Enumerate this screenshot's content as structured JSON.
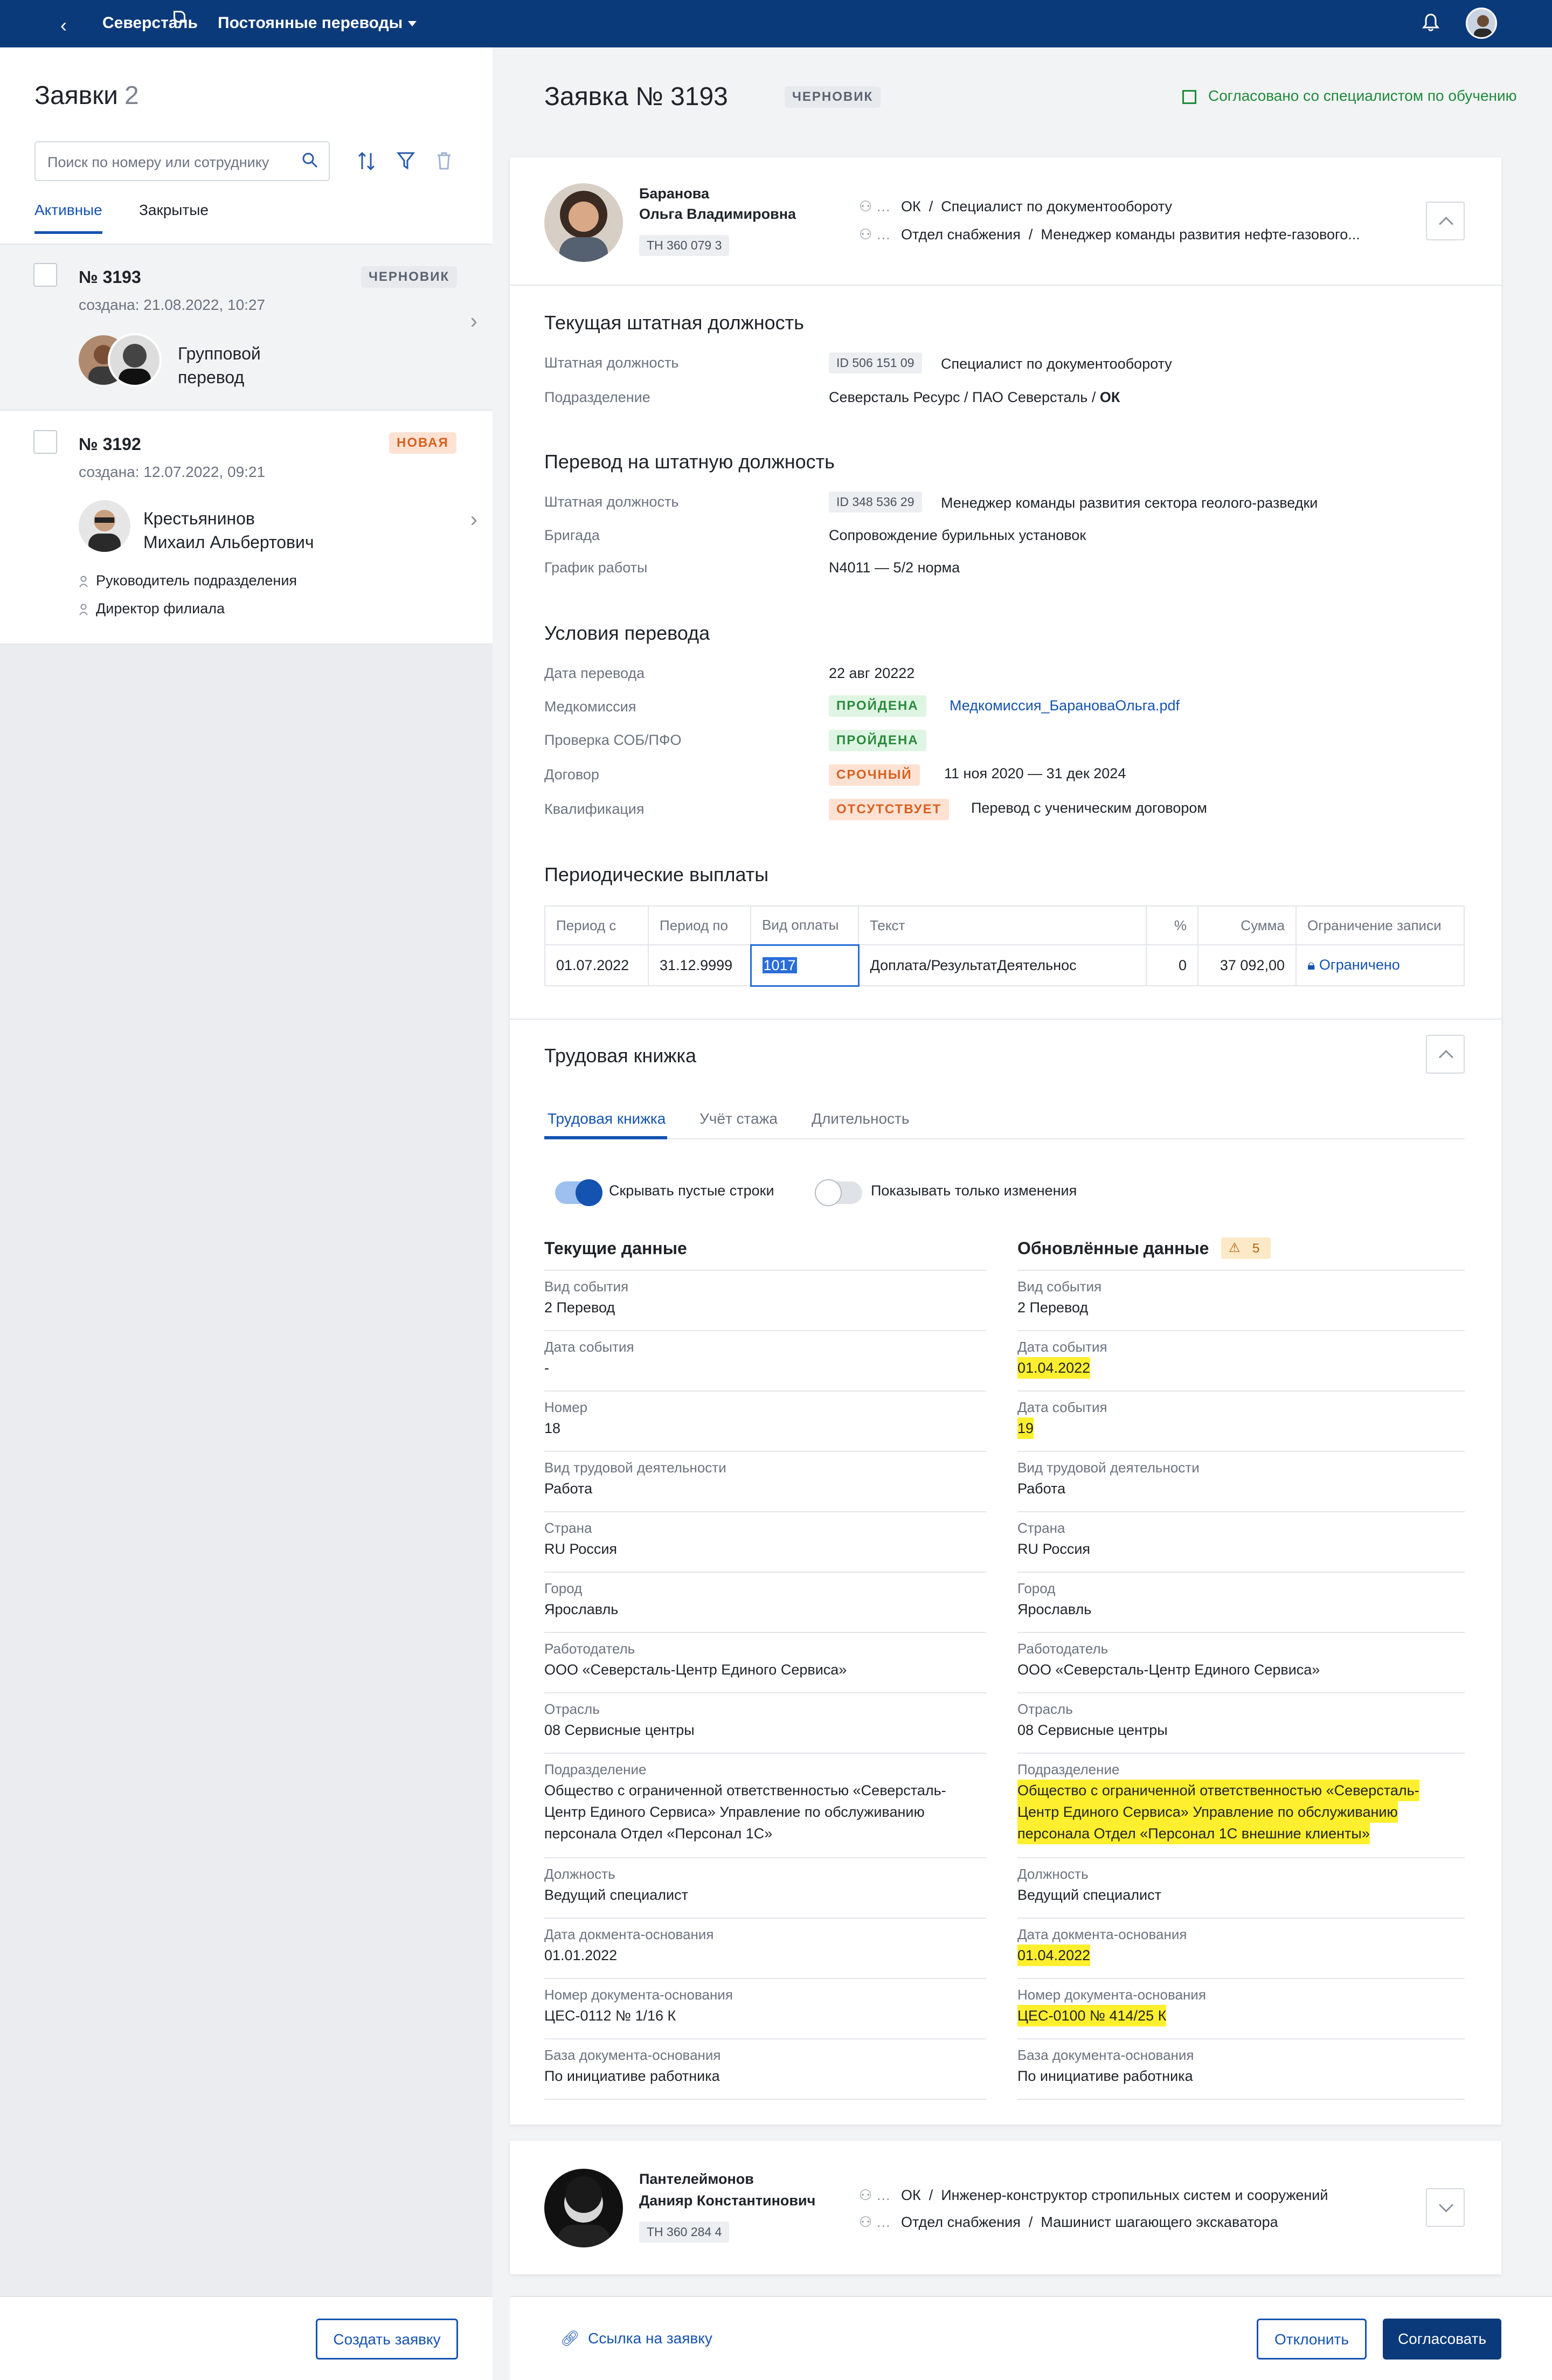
{
  "topbar": {
    "logo": "Северсталь",
    "menu": "Постоянные переводы"
  },
  "left": {
    "title": "Заявки",
    "count": "2",
    "search_placeholder": "Поиск по номеру или сотруднику",
    "tabs": [
      "Активные",
      "Закрытые"
    ],
    "cards": [
      {
        "num": "№ 3193",
        "created": "создана: 21.08.2022, 10:27",
        "badge": "ЧЕРНОВИК",
        "name1": "Групповой",
        "name2": "перевод"
      },
      {
        "num": "№ 3192",
        "created": "создана: 12.07.2022, 09:21",
        "badge": "НОВАЯ",
        "name1": "Крестьянинов",
        "name2": "Михаил Альбертович",
        "roles": [
          "Руководитель подразделения",
          "Директор филиала"
        ]
      }
    ],
    "create_button": "Создать заявку"
  },
  "request": {
    "title": "Заявка № 3193",
    "badge": "ЧЕРНОВИК",
    "agreed": "Согласовано со специалистом по обучению"
  },
  "employee1": {
    "last": "Баранова",
    "first": "Ольга Владимировна",
    "tn": "ТН 360 079 3",
    "route1_a": "ОК",
    "route1_b": "Специалист по документообороту",
    "route2_a": "Отдел снабжения",
    "route2_b": "Менеджер команды развития нефте-газового..."
  },
  "current_position": {
    "title": "Текущая штатная должность",
    "l1": "Штатная должность",
    "id1": "ID 506 151 09",
    "v1": "Специалист по документообороту",
    "l2": "Подразделение",
    "v2": "Северсталь Ресурс / ПАО Северсталь / ",
    "v2b": "ОК"
  },
  "transfer_position": {
    "title": "Перевод на штатную должность",
    "l1": "Штатная должность",
    "id1": "ID 348 536 29",
    "v1": "Менеджер команды развития сектора геолого-разведки",
    "l2": "Бригада",
    "v2": "Сопровождение бурильных установок",
    "l3": "График работы",
    "v3": "N4011 — 5/2 норма"
  },
  "conditions": {
    "title": "Условия перевода",
    "l1": "Дата перевода",
    "v1": "22 авг 20222",
    "l2": "Медкомиссия",
    "p2": "ПРОЙДЕНА",
    "file2": "Медкомиссия_БарановаОльга.pdf",
    "l3": "Проверка СОБ/ПФО",
    "p3": "ПРОЙДЕНА",
    "l4": "Договор",
    "p4": "СРОЧНЫЙ",
    "v4": "11 ноя 2020 — 31 дек 2024",
    "l5": "Квалификация",
    "p5": "ОТСУТСТВУЕТ",
    "v5": "Перевод с ученическим договором"
  },
  "payments": {
    "title": "Периодические выплаты",
    "headers": [
      "Период с",
      "Период по",
      "Вид оплаты",
      "Текст",
      "%",
      "Сумма",
      "Ограничение записи"
    ],
    "row": [
      "01.07.2022",
      "31.12.9999",
      "1017",
      "Доплата/РезультатДеятельнос",
      "0",
      "37 092,00",
      "Ограничено"
    ]
  },
  "workbook": {
    "title": "Трудовая книжка",
    "tabs": [
      "Трудовая книжка",
      "Учёт стажа",
      "Длительность"
    ],
    "toggle1": "Скрывать пустые строки",
    "toggle2": "Показывать только изменения",
    "current_h": "Текущие данные",
    "updated_h": "Обновлённые данные",
    "warn_count": "5",
    "rows": [
      {
        "l": "Вид события",
        "c": "2 Перевод",
        "ul": "Вид события",
        "u": "2 Перевод"
      },
      {
        "l": "Дата события",
        "c": "-",
        "ul": "Дата события",
        "u": "01.04.2022"
      },
      {
        "l": "Номер",
        "c": "18",
        "ul": "Дата события",
        "u": "19"
      },
      {
        "l": "Вид трудовой деятельности",
        "c": "Работа",
        "ul": "Вид трудовой деятельности",
        "u": "Работа"
      },
      {
        "l": "Страна",
        "c": "RU Россия",
        "ul": "Страна",
        "u": "RU Россия"
      },
      {
        "l": "Город",
        "c": "Ярославль",
        "ul": "Город",
        "u": "Ярославль"
      },
      {
        "l": "Работодатель",
        "c": "ООО «Северсталь-Центр Единого Сервиса»",
        "ul": "Работодатель",
        "u": "ООО «Северсталь-Центр Единого Сервиса»"
      },
      {
        "l": "Отрасль",
        "c": "08 Сервисные центры",
        "ul": "Отрасль",
        "u": "08 Сервисные центры"
      }
    ],
    "dept_l": "Подразделение",
    "dept_c": [
      "Общество с ограниченной ответственностью «Северсталь-",
      "Центр Единого Сервиса» Управление по обслуживанию",
      "персонала Отдел «Персонал 1С»"
    ],
    "dept_u": [
      "Общество с ограниченной ответственностью «Северсталь-",
      "Центр Единого Сервиса» Управление по обслуживанию",
      "персонала Отдел «Персонал 1С внешние клиенты»"
    ],
    "rows2": [
      {
        "l": "Должность",
        "c": "Ведущий специалист",
        "u": "Ведущий специалист"
      },
      {
        "l": "Дата докмента-основания",
        "c": "01.01.2022",
        "u": "01.04.2022"
      },
      {
        "l": "Номер документа-основания",
        "c": "ЦЕС-0112 № 1/16 К",
        "u": "ЦЕС-0100 № 414/25 К"
      },
      {
        "l": "База документа-основания",
        "c": "По инициативе работника",
        "u": "По инициативе работника"
      }
    ]
  },
  "employee2": {
    "last": "Пантелеймонов",
    "first": "Данияр Константинович",
    "tn": "ТН 360 284 4",
    "route1_a": "ОК",
    "route1_b": "Инженер-конструктор стропильных систем и сооружений",
    "route2_a": "Отдел снабжения",
    "route2_b": "Машинист шагающего экскаватора"
  },
  "footer": {
    "link": "Ссылка на заявку",
    "reject": "Отклонить",
    "approve": "Согласовать"
  }
}
